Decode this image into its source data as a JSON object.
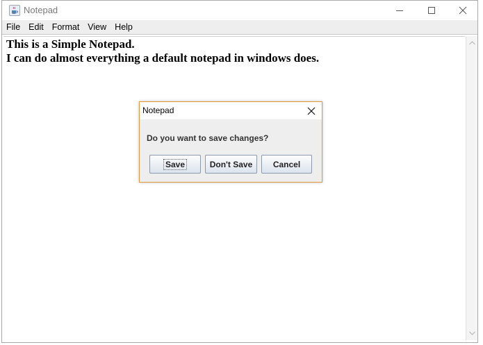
{
  "window": {
    "title": "Notepad",
    "icon": "java-coffee-cup-icon",
    "controls": [
      "minimize-icon",
      "maximize-icon",
      "close-icon"
    ]
  },
  "menu": {
    "items": [
      "File",
      "Edit",
      "Format",
      "View",
      "Help"
    ]
  },
  "editor": {
    "lines": [
      "This is a Simple Notepad.",
      "I can do almost everything a default notepad in windows does."
    ]
  },
  "dialog": {
    "title": "Notepad",
    "message": "Do you want to save changes?",
    "buttons": {
      "save": "Save",
      "dont_save": "Don't Save",
      "cancel": "Cancel"
    }
  },
  "colors": {
    "dialog_border": "#e09a3b",
    "button_border": "#8a99ad",
    "menubar_bg": "#eeeeee"
  }
}
